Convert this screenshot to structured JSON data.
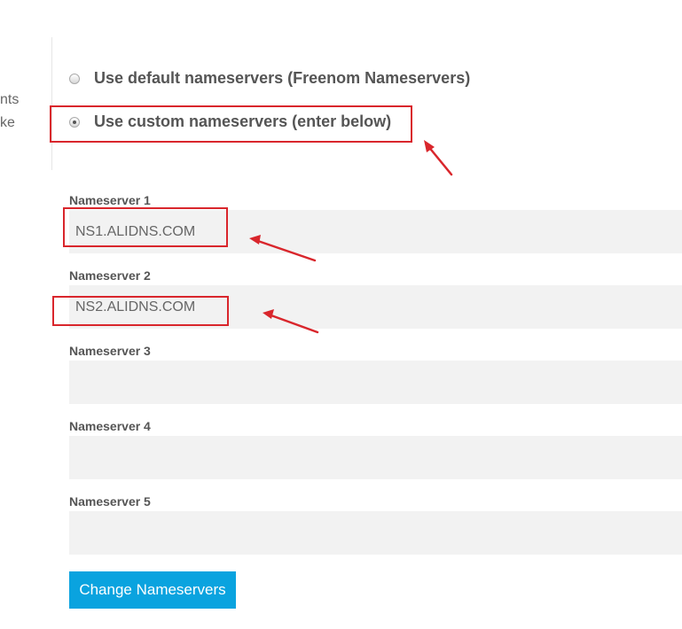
{
  "left_fragment": {
    "line1": "nts",
    "line2": "ke"
  },
  "nameserver_options": {
    "default_label": "Use default nameservers (Freenom Nameservers)",
    "custom_label": "Use custom nameservers (enter below)",
    "selected": "custom"
  },
  "fields": [
    {
      "label": "Nameserver 1",
      "value": "NS1.ALIDNS.COM"
    },
    {
      "label": "Nameserver 2",
      "value": "NS2.ALIDNS.COM"
    },
    {
      "label": "Nameserver 3",
      "value": ""
    },
    {
      "label": "Nameserver 4",
      "value": ""
    },
    {
      "label": "Nameserver 5",
      "value": ""
    }
  ],
  "submit": {
    "label": "Change Nameservers"
  },
  "colors": {
    "accent": "#0aa3df",
    "annotation": "#d9262c",
    "input_bg": "#f2f2f2"
  }
}
